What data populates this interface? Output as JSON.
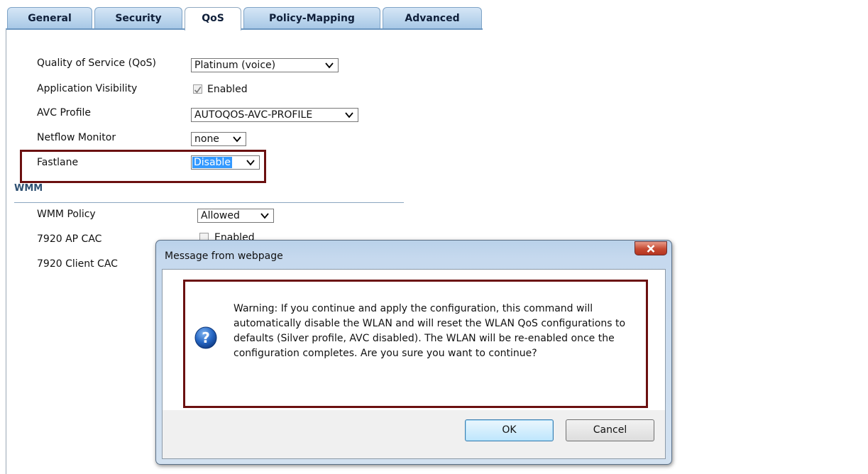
{
  "tabs": [
    {
      "label": "General"
    },
    {
      "label": "Security"
    },
    {
      "label": "QoS"
    },
    {
      "label": "Policy-Mapping"
    },
    {
      "label": "Advanced"
    }
  ],
  "active_tab": "QoS",
  "form": {
    "qos": {
      "label": "Quality of Service (QoS)",
      "value": "Platinum (voice)"
    },
    "app_visibility": {
      "label": "Application Visibility",
      "checkbox_label": "Enabled",
      "checked": true
    },
    "avc_profile": {
      "label": "AVC Profile",
      "value": "AUTOQOS-AVC-PROFILE"
    },
    "netflow": {
      "label": "Netflow Monitor",
      "value": "none"
    },
    "fastlane": {
      "label": "Fastlane",
      "value": "Disable"
    }
  },
  "wmm": {
    "title": "WMM",
    "policy": {
      "label": "WMM Policy",
      "value": "Allowed"
    },
    "ap_cac": {
      "label": "7920 AP CAC",
      "checkbox_label": "Enabled"
    },
    "client_cac": {
      "label": "7920 Client CAC"
    }
  },
  "dialog": {
    "title": "Message from webpage",
    "message": "Warning: If you continue and apply the configuration, this command will automatically disable the WLAN and will reset the WLAN QoS configurations to defaults (Silver profile, AVC disabled). The WLAN will be re-enabled once the configuration completes. Are you sure you want to continue?",
    "ok_label": "OK",
    "cancel_label": "Cancel",
    "close_glyph": "x",
    "icon": "question-icon"
  },
  "colors": {
    "tab_gradient_top": "#d5e6f6",
    "tab_gradient_bottom": "#a8c8e6",
    "highlight_border": "#6b1010",
    "section_title": "#2f5173",
    "selection_bg": "#3399ff"
  }
}
